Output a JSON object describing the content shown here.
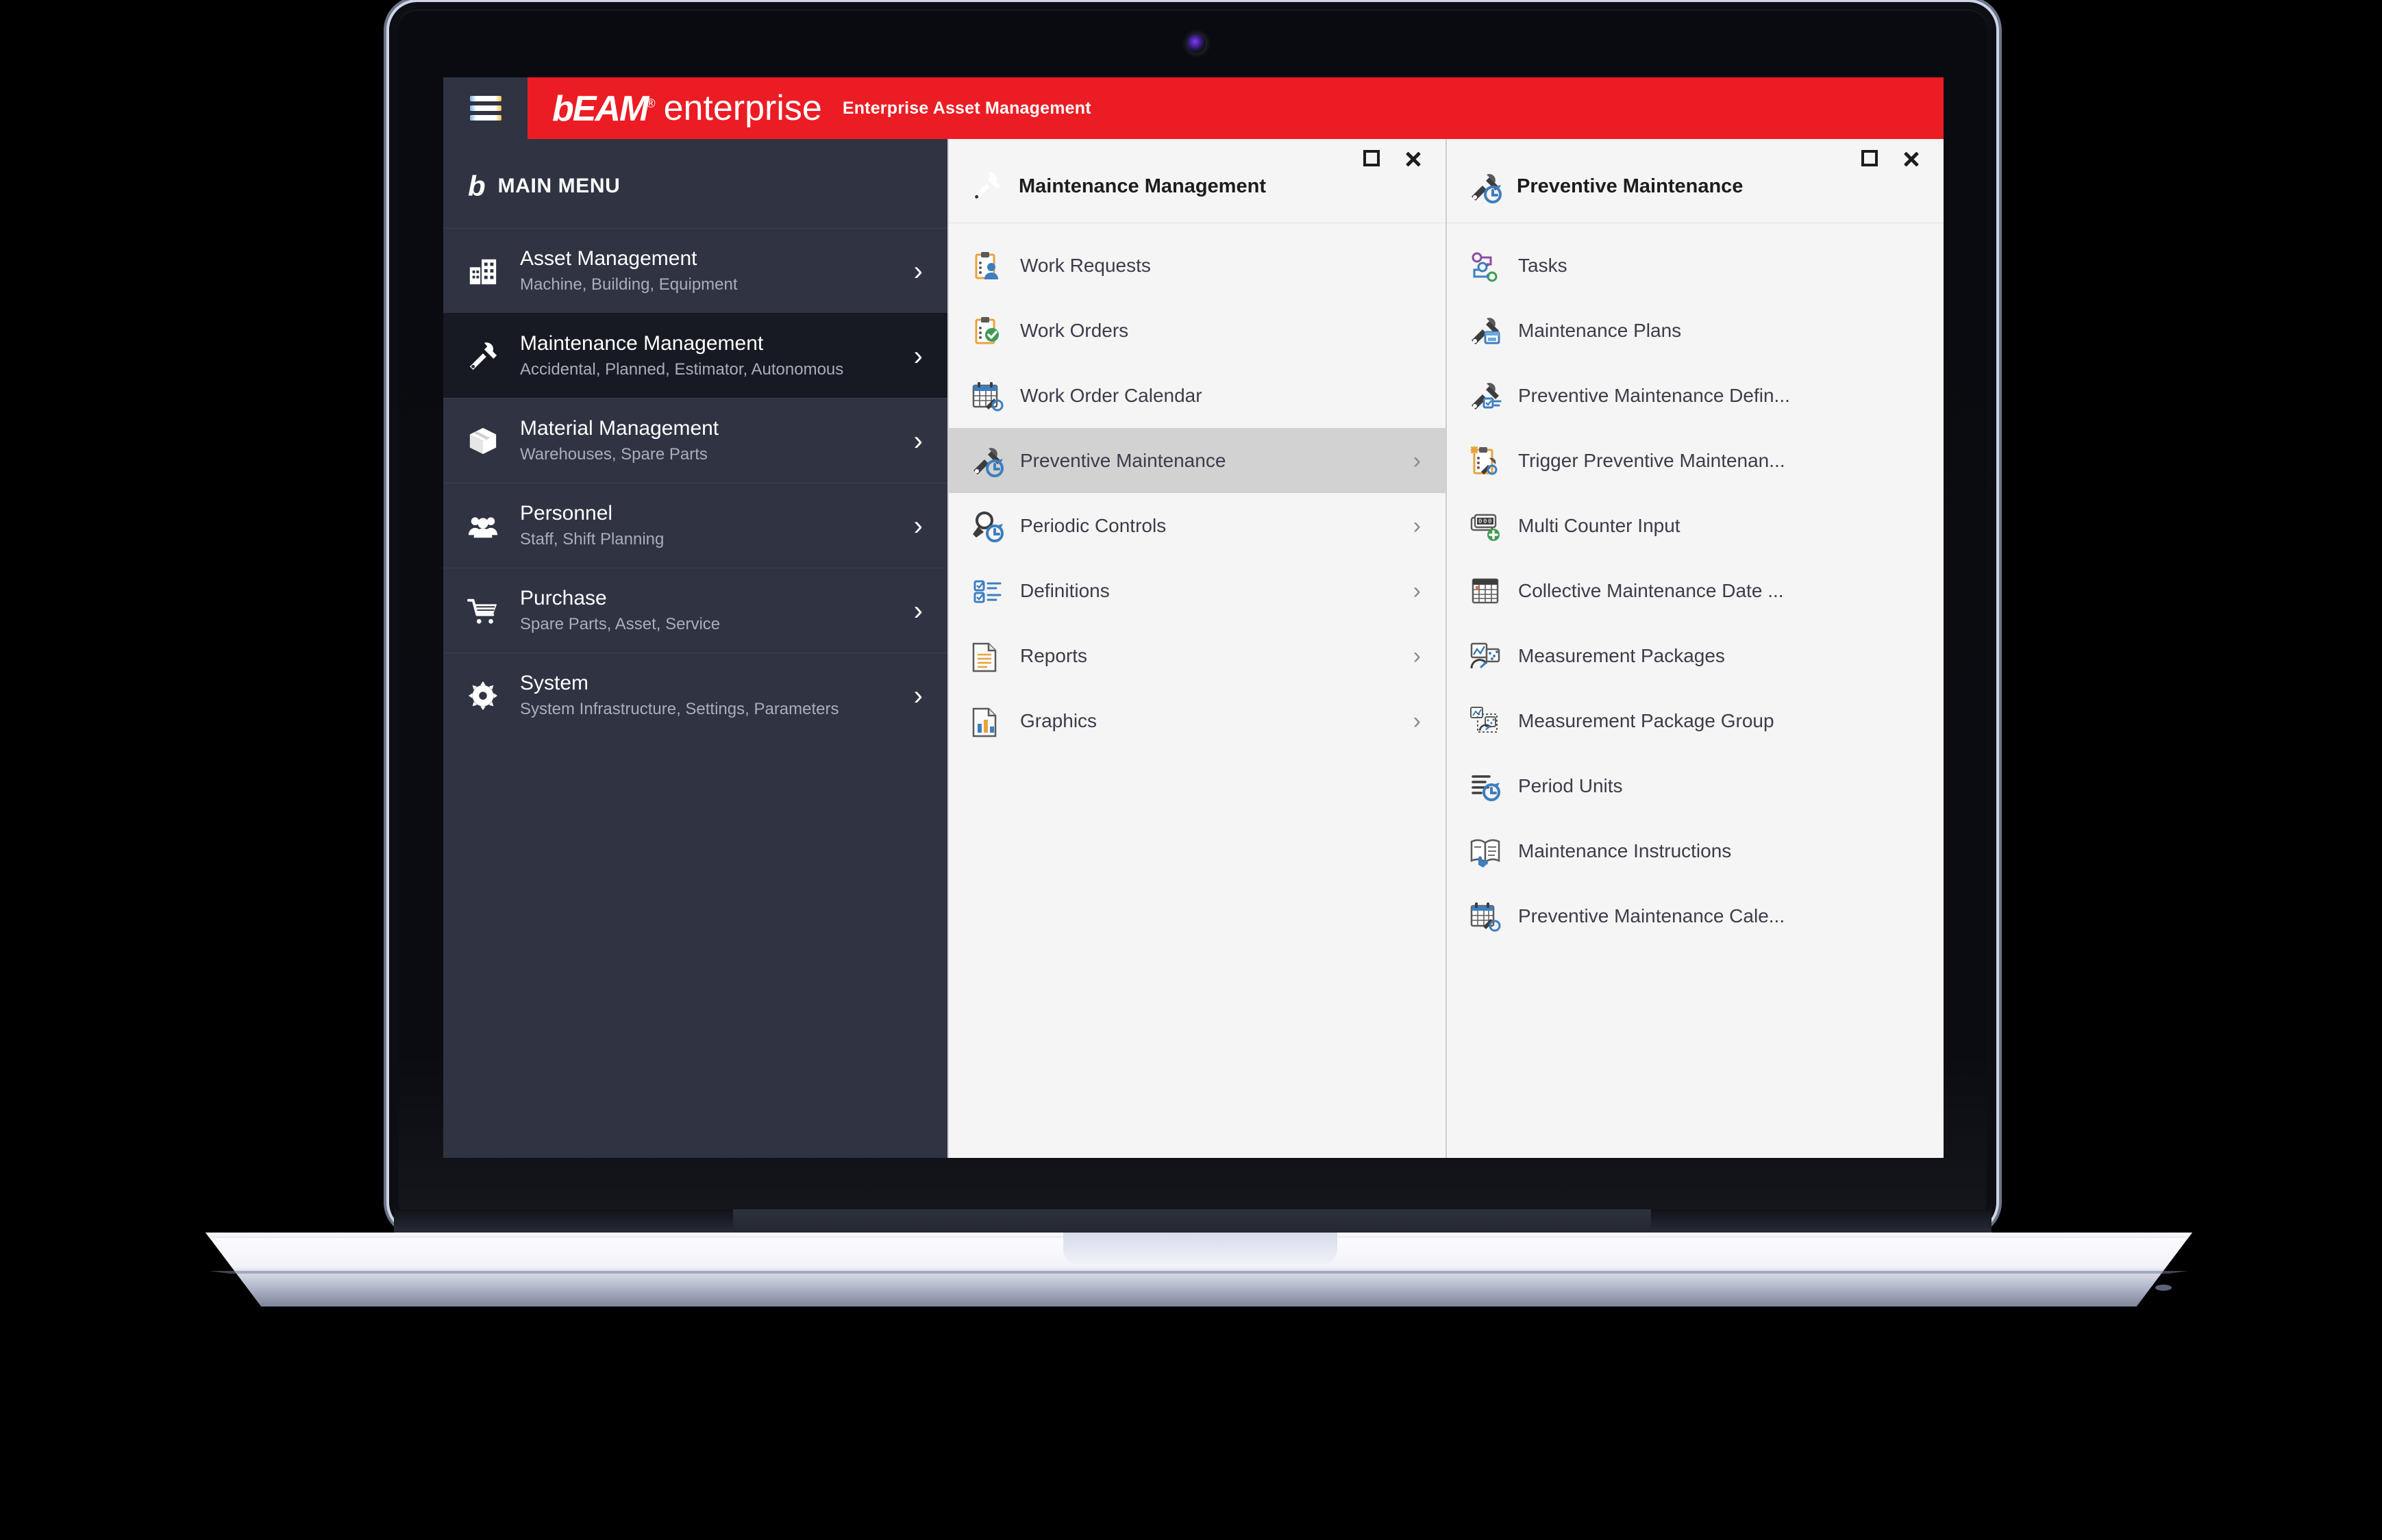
{
  "app": {
    "logo_mark": "b",
    "logo_registered": "®",
    "logo_word": "enterprise",
    "logo_letters": "EAM",
    "tagline": "Enterprise Asset Management",
    "brand_red": "#ec1c24",
    "sidebar_bg": "#2f3342",
    "hamburger_icon": "hamburger-menu-icon"
  },
  "sidebar": {
    "heading": "MAIN MENU",
    "heading_mark": "b",
    "items": [
      {
        "title": "Asset Management",
        "subtitle": "Machine, Building, Equipment",
        "icon": "building-icon",
        "chevron": "›",
        "active": false
      },
      {
        "title": "Maintenance Management",
        "subtitle": "Accidental, Planned, Estimator, Autonomous",
        "icon": "wrench-screwdriver-icon",
        "chevron": "›",
        "active": true
      },
      {
        "title": "Material Management",
        "subtitle": "Warehouses, Spare Parts",
        "icon": "box-package-icon",
        "chevron": "›",
        "active": false
      },
      {
        "title": "Personnel",
        "subtitle": "Staff, Shift Planning",
        "icon": "people-group-icon",
        "chevron": "›",
        "active": false
      },
      {
        "title": "Purchase",
        "subtitle": "Spare Parts, Asset, Service",
        "icon": "shopping-cart-icon",
        "chevron": "›",
        "active": false
      },
      {
        "title": "System",
        "subtitle": "System Infrastructure, Settings, Parameters",
        "icon": "gear-icon",
        "chevron": "›",
        "active": false
      }
    ]
  },
  "panels": [
    {
      "title": "Maintenance Management",
      "title_icon": "wrench-screwdriver-icon",
      "maximize_icon": "maximize-icon",
      "close_icon": "close-icon",
      "items": [
        {
          "label": "Work Requests",
          "icon": "clipboard-person-icon",
          "chevron": "",
          "selected": false
        },
        {
          "label": "Work Orders",
          "icon": "clipboard-check-icon",
          "chevron": "",
          "selected": false
        },
        {
          "label": "Work Order Calendar",
          "icon": "calendar-wrench-icon",
          "chevron": "",
          "selected": false
        },
        {
          "label": "Preventive Maintenance",
          "icon": "wrench-clock-icon",
          "chevron": "›",
          "selected": true
        },
        {
          "label": "Periodic Controls",
          "icon": "magnifier-clock-icon",
          "chevron": "›",
          "selected": false
        },
        {
          "label": "Definitions",
          "icon": "checklist-icon",
          "chevron": "›",
          "selected": false
        },
        {
          "label": "Reports",
          "icon": "document-lines-icon",
          "chevron": "›",
          "selected": false
        },
        {
          "label": "Graphics",
          "icon": "document-chart-icon",
          "chevron": "›",
          "selected": false
        }
      ]
    },
    {
      "title": "Preventive Maintenance",
      "title_icon": "wrench-clock-icon",
      "maximize_icon": "maximize-icon",
      "close_icon": "close-icon",
      "items": [
        {
          "label": "Tasks",
          "icon": "flow-nodes-icon",
          "chevron": "",
          "selected": false
        },
        {
          "label": "Maintenance Plans",
          "icon": "wrench-window-icon",
          "chevron": "",
          "selected": false
        },
        {
          "label": "Preventive Maintenance Defin...",
          "icon": "wrench-checklist-icon",
          "chevron": "",
          "selected": false
        },
        {
          "label": "Trigger Preventive Maintenan...",
          "icon": "clipboard-spark-wrench-icon",
          "chevron": "",
          "selected": false
        },
        {
          "label": "Multi Counter Input",
          "icon": "counter-plus-icon",
          "chevron": "",
          "selected": false
        },
        {
          "label": "Collective Maintenance Date ...",
          "icon": "calendar-grid-icon",
          "chevron": "",
          "selected": false
        },
        {
          "label": "Measurement Packages",
          "icon": "measurement-gauge-icon",
          "chevron": "",
          "selected": false
        },
        {
          "label": "Measurement Package Group",
          "icon": "measurement-group-icon",
          "chevron": "",
          "selected": false
        },
        {
          "label": "Period Units",
          "icon": "lines-clock-icon",
          "chevron": "",
          "selected": false
        },
        {
          "label": "Maintenance Instructions",
          "icon": "open-book-hand-icon",
          "chevron": "",
          "selected": false
        },
        {
          "label": "Preventive Maintenance Cale...",
          "icon": "calendar-wrench-clock-icon",
          "chevron": "",
          "selected": false
        }
      ]
    }
  ]
}
